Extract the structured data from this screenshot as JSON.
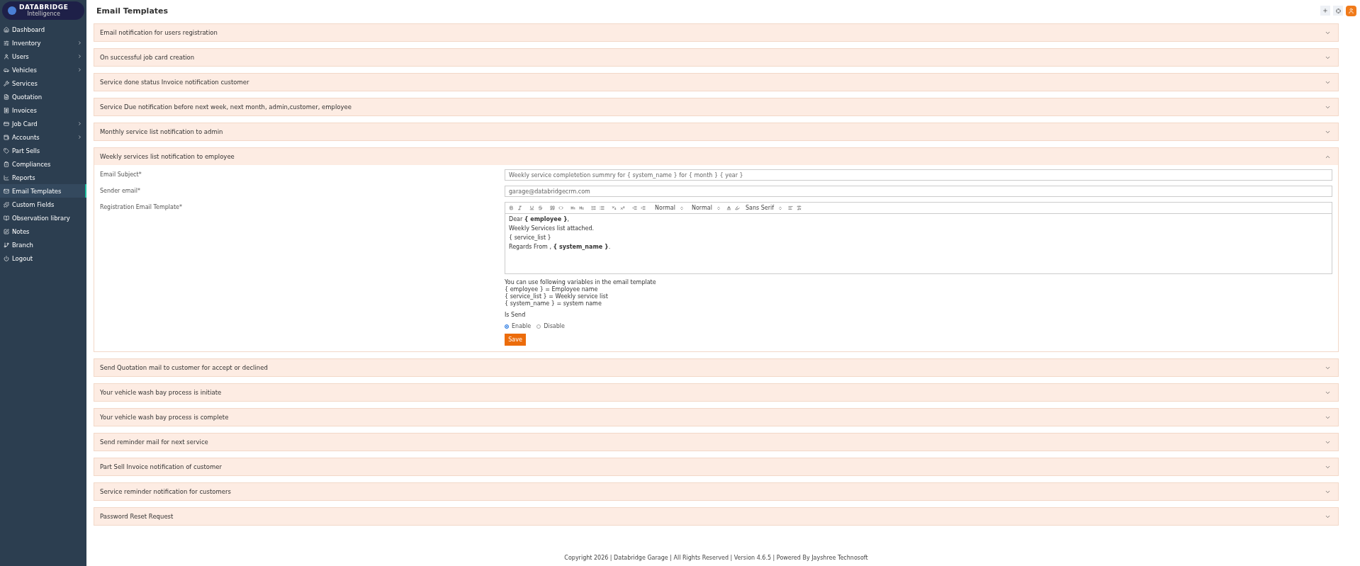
{
  "sidebar": {
    "logo": {
      "title": "DATABRIDGE",
      "subtitle": "Intelligence"
    },
    "items": [
      {
        "label": "Dashboard",
        "expandable": false,
        "selected": false
      },
      {
        "label": "Inventory",
        "expandable": true,
        "selected": false
      },
      {
        "label": "Users",
        "expandable": true,
        "selected": false
      },
      {
        "label": "Vehicles",
        "expandable": true,
        "selected": false
      },
      {
        "label": "Services",
        "expandable": false,
        "selected": false
      },
      {
        "label": "Quotation",
        "expandable": false,
        "selected": false
      },
      {
        "label": "Invoices",
        "expandable": false,
        "selected": false
      },
      {
        "label": "Job Card",
        "expandable": true,
        "selected": false
      },
      {
        "label": "Accounts",
        "expandable": true,
        "selected": false
      },
      {
        "label": "Part Sells",
        "expandable": false,
        "selected": false
      },
      {
        "label": "Compliances",
        "expandable": false,
        "selected": false
      },
      {
        "label": "Reports",
        "expandable": false,
        "selected": false
      },
      {
        "label": "Email Templates",
        "expandable": false,
        "selected": true
      },
      {
        "label": "Custom Fields",
        "expandable": false,
        "selected": false
      },
      {
        "label": "Observation library",
        "expandable": false,
        "selected": false
      },
      {
        "label": "Notes",
        "expandable": false,
        "selected": false
      },
      {
        "label": "Branch",
        "expandable": false,
        "selected": false
      },
      {
        "label": "Logout",
        "expandable": false,
        "selected": false
      }
    ]
  },
  "page": {
    "title": "Email Templates"
  },
  "templates": [
    {
      "title": "Email notification for users registration",
      "expanded": false
    },
    {
      "title": "On successful job card creation",
      "expanded": false
    },
    {
      "title": "Service done status Invoice notification customer",
      "expanded": false
    },
    {
      "title": "Service Due notification before next week, next month, admin,customer, employee",
      "expanded": false
    },
    {
      "title": "Monthly service list notification to admin",
      "expanded": false
    },
    {
      "title": "Weekly services list notification to employee",
      "expanded": true,
      "form": {
        "subject": {
          "label": "Email Subject*",
          "value": "Weekly service completetion summry for { system_name } for { month } { year }"
        },
        "sender": {
          "label": "Sender email*",
          "value": "garage@databridgecrm.com"
        },
        "template": {
          "label": "Registration Email Template*",
          "selects": [
            "Normal",
            "Normal",
            "Sans Serif"
          ],
          "lines": [
            "Dear **{ employee }**,",
            "Weekly Services list attached.",
            "{ service_list }",
            "Regards From , **{ system_name }**."
          ]
        },
        "variables_intro": "You can use following variables in the email template",
        "variables": [
          "{ employee } = Employee name",
          "{ service_list } = Weekly service list",
          "{ system_name } = system name"
        ],
        "send_label": "Is Send",
        "send_options": [
          {
            "label": "Enable",
            "selected": true
          },
          {
            "label": "Disable",
            "selected": false
          }
        ],
        "save": "Save"
      }
    },
    {
      "title": "Send Quotation mail to customer for accept or declined",
      "expanded": false
    },
    {
      "title": "Your vehicle wash bay process is initiate",
      "expanded": false
    },
    {
      "title": "Your vehicle wash bay process is complete",
      "expanded": false
    },
    {
      "title": "Send reminder mail for next service",
      "expanded": false
    },
    {
      "title": "Part Sell Invoice notification of customer",
      "expanded": false
    },
    {
      "title": "Service reminder notification for customers",
      "expanded": false
    },
    {
      "title": "Password Reset Request",
      "expanded": false
    }
  ],
  "footer": "Copyright 2026 | Databridge Garage | All Rights Reserved | Version 4.6.5 | Powered By Jayshree Technosoft"
}
